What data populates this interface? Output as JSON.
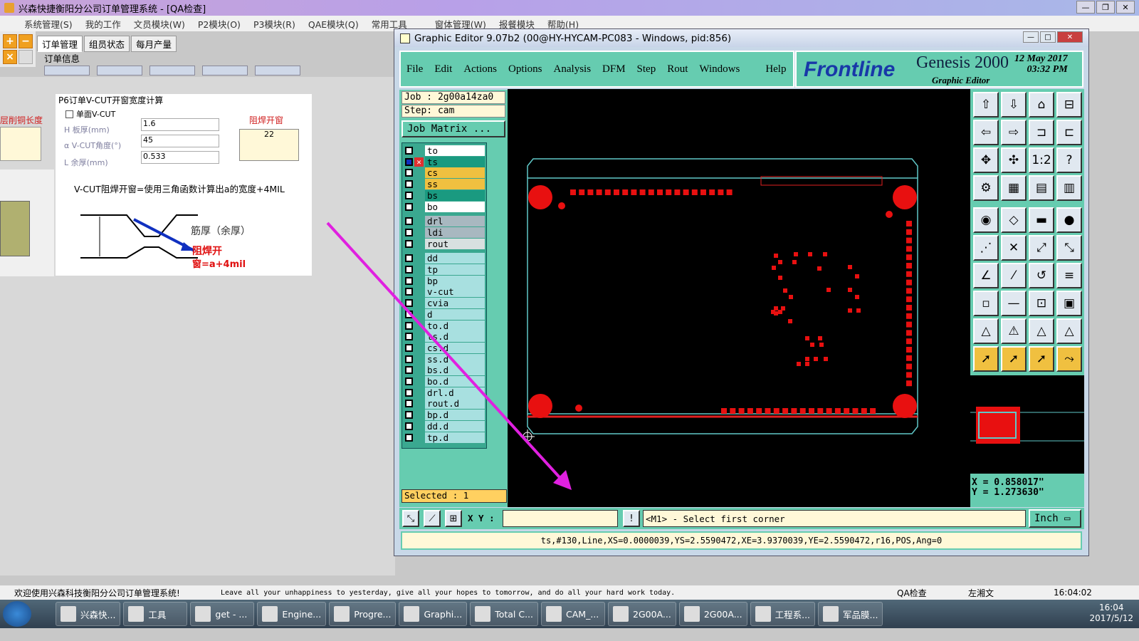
{
  "main": {
    "title": "兴森快捷衡阳分公司订单管理系统 - [QA检查]",
    "menu": [
      "系统管理(S)",
      "我的工作",
      "文员模块(W)",
      "P2模块(O)",
      "P3模块(R)",
      "QAE模块(Q)",
      "常用工具",
      "窗体管理(W)",
      "报餐模块",
      "帮助(H)"
    ],
    "tabs": [
      "订单管理",
      "组员状态",
      "每月产量"
    ],
    "order_info": "订单信息",
    "calc_title": "P6订单V-CUT开窗宽度计算",
    "single_vcut": "单面V-CUT",
    "fields": [
      {
        "label": "H 板厚(mm)",
        "value": "1.6"
      },
      {
        "label": "α V-CUT角度(°)",
        "value": "45"
      },
      {
        "label": "L 余厚(mm)",
        "value": "0.533"
      }
    ],
    "solder_window_label": "阻焊开窗",
    "solder_window_value": "22",
    "left_label": "层削铜长度",
    "formula": "V-CUT阻焊开窗=使用三角函数计算出a的宽度+4MIL",
    "diagram_rib": "筋厚（余厚）",
    "diagram_note1": "阻焊开",
    "diagram_note2": "窗=a+4mil",
    "status_welcome": "欢迎使用兴森科技衡阳分公司订单管理系统!",
    "status_motto": "Leave all your unhappiness to yesterday, give all your hopes to tomorrow, and do all your hard work today.",
    "status_module": "QA检查",
    "status_user": "左湘文",
    "status_time": "16:04:02"
  },
  "taskbar": {
    "items": [
      "兴森快...",
      "工具",
      "get - ...",
      "Engine...",
      "Progre...",
      "Graphi...",
      "Total C...",
      "CAM_...",
      "2G00A...",
      "2G00A...",
      "工程系...",
      "军品膜..."
    ],
    "time": "16:04",
    "date": "2017/5/12"
  },
  "genesis": {
    "title": "Graphic Editor 9.07b2 (00@HY-HYCAM-PC083 - Windows, pid:856)",
    "menu": [
      "File",
      "Edit",
      "Actions",
      "Options",
      "Analysis",
      "DFM",
      "Step",
      "Rout",
      "Windows",
      "Help"
    ],
    "brand": "Frontline",
    "product": "Genesis 2000",
    "subtitle": "Graphic Editor",
    "date": "12 May 2017",
    "time": "03:32 PM",
    "job": "Job : 2g00a14za0",
    "step": "Step: cam",
    "job_matrix": "Job Matrix ...",
    "selected": "Selected : 1",
    "layers": [
      {
        "name": "to",
        "color": "#ffffff"
      },
      {
        "name": "ts",
        "color": "#1a9a80"
      },
      {
        "name": "cs",
        "color": "#f0c040"
      },
      {
        "name": "ss",
        "color": "#f0c040"
      },
      {
        "name": "bs",
        "color": "#1a9a80"
      },
      {
        "name": "bo",
        "color": "#ffffff"
      },
      {
        "name": "drl",
        "color": "#a8b8c0"
      },
      {
        "name": "ldi",
        "color": "#a8b8c0"
      },
      {
        "name": "rout",
        "color": "#d8e0e0"
      },
      {
        "name": "dd",
        "color": "#a8e0e0"
      },
      {
        "name": "tp",
        "color": "#a8e0e0"
      },
      {
        "name": "bp",
        "color": "#a8e0e0"
      },
      {
        "name": "v-cut",
        "color": "#a8e0e0"
      },
      {
        "name": "cvia",
        "color": "#a8e0e0"
      },
      {
        "name": "d",
        "color": "#a8e0e0"
      },
      {
        "name": "to.d",
        "color": "#a8e0e0"
      },
      {
        "name": "ts.d",
        "color": "#a8e0e0"
      },
      {
        "name": "cs.d",
        "color": "#a8e0e0"
      },
      {
        "name": "ss.d",
        "color": "#a8e0e0"
      },
      {
        "name": "bs.d",
        "color": "#a8e0e0"
      },
      {
        "name": "bo.d",
        "color": "#a8e0e0"
      },
      {
        "name": "drl.d",
        "color": "#a8e0e0"
      },
      {
        "name": "rout.d",
        "color": "#a8e0e0"
      },
      {
        "name": "bp.d",
        "color": "#a8e0e0"
      },
      {
        "name": "dd.d",
        "color": "#a8e0e0"
      },
      {
        "name": "tp.d",
        "color": "#a8e0e0"
      }
    ],
    "coord_x": "X = 0.858017\"",
    "coord_y": "Y = 1.273630\"",
    "xy_label": "X Y :",
    "prompt": "<M1> - Select first corner",
    "unit": "Inch",
    "info_line": "ts,#130,Line,XS=0.0000039,YS=2.5590472,XE=3.9370039,YE=2.5590472,r16,POS,Ang=0"
  }
}
